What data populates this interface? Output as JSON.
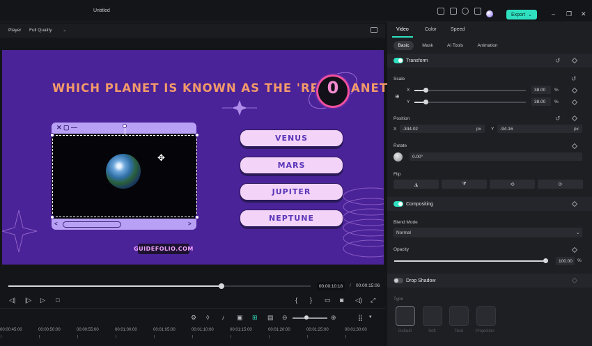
{
  "window": {
    "title": "Untitled",
    "export_label": "Export"
  },
  "player": {
    "label": "Player",
    "quality": "Full Quality"
  },
  "preview": {
    "question": "WHICH PLANET IS KNOWN AS THE 'RED PLANET'?",
    "timer": "0",
    "answers": [
      "VENUS",
      "MARS",
      "JUPITER",
      "NEPTUNE"
    ],
    "brand": "GUIDEFOLIO.COM"
  },
  "playback": {
    "current_time": "00:00:10:18",
    "separator": "/",
    "total_time": "00:00:15:06",
    "progress": 0.705
  },
  "timeline": {
    "ticks": [
      "00:00:45:00",
      "00:00:50:00",
      "00:00:55:00",
      "00:01:00:00",
      "00:01:05:00",
      "00:01:10:00",
      "00:01:15:00",
      "00:01:20:00",
      "00:01:25:00",
      "00:01:30:00"
    ]
  },
  "panel": {
    "tabs": [
      "Video",
      "Color",
      "Speed"
    ],
    "subtabs": [
      "Basic",
      "Mask",
      "AI Tools",
      "Animation"
    ],
    "transform_label": "Transform",
    "scale_label": "Scale",
    "scale_x_label": "X",
    "scale_y_label": "Y",
    "scale_x_value": "38.00",
    "scale_y_value": "38.00",
    "percent": "%",
    "position_label": "Position",
    "pos_x_label": "X",
    "pos_x_value": "-344.02",
    "pos_y_label": "Y",
    "pos_y_value": "-94.16",
    "px": "px",
    "rotate_label": "Rotate",
    "rotate_value": "0.00°",
    "flip_label": "Flip",
    "compositing_label": "Compositing",
    "blend_mode_label": "Blend Mode",
    "blend_mode_value": "Normal",
    "opacity_label": "Opacity",
    "opacity_value": "100.00",
    "drop_shadow_label": "Drop Shadow",
    "type_label": "Type",
    "shadow_types": [
      "Default",
      "Soft",
      "Tiled",
      "Projection"
    ]
  },
  "colors": {
    "accent": "#2fe0c0",
    "preview_bg": "#4b2398",
    "question": "#f39a6a",
    "answer_bg": "#f3d4f8"
  }
}
